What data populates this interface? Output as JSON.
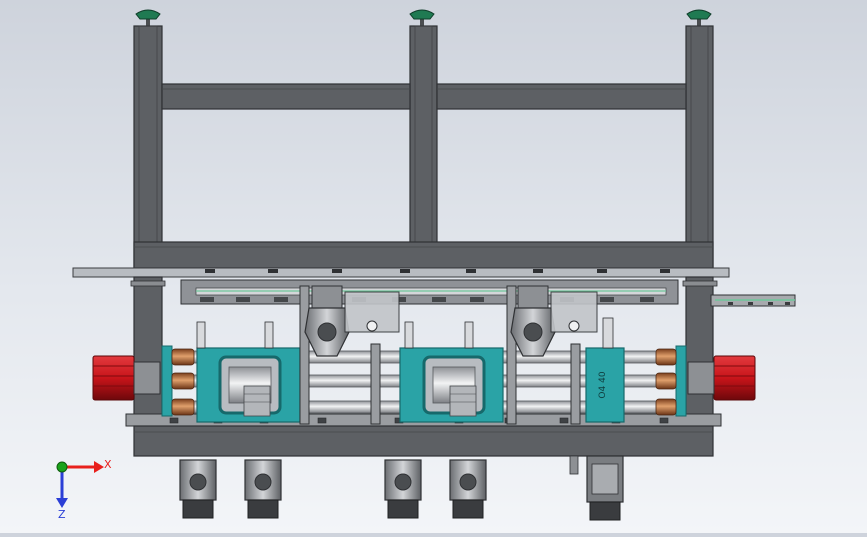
{
  "viewport": {
    "background_top": "#ced3dc",
    "background_bottom": "#f3f5f8"
  },
  "model": {
    "frame_color": "#5d6064",
    "frame_edge": "#2f3134",
    "plate_color": "#b8bcc1",
    "motor_color": "#c8141a",
    "motor_dark": "#7d0a0e",
    "clamp_color": "#2aa3a6",
    "clamp_dark": "#16696b",
    "pad_color": "#1f7a52",
    "copper_color": "#b3683a",
    "rail_color": "#6fc79a",
    "part_label": "O4 40"
  },
  "triad": {
    "x_label": "X",
    "z_label": "Z",
    "x_color": "#e8201c",
    "y_color": "#1aa21a",
    "z_color": "#2b3fd6"
  }
}
